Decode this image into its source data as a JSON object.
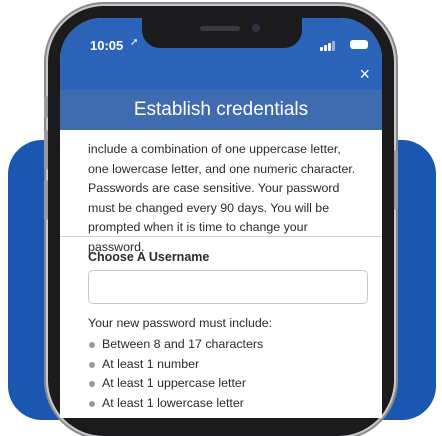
{
  "status_bar": {
    "time": "10:05"
  },
  "modal": {
    "close_label": "×",
    "title": "Establish credentials",
    "intro_text": "include a combination of one uppercase letter, one lowercase letter, and one numeric character. Passwords are case sensitive. Your password must be changed every 90 days.  You will be prompted when it is time to change your password.",
    "username": {
      "label": "Choose A Username",
      "value": "",
      "placeholder": ""
    },
    "requirements": {
      "title": "Your new password must include:",
      "items": [
        "Between 8 and 17 characters",
        "At least 1 number",
        "At least 1 uppercase letter",
        "At least 1 lowercase letter"
      ]
    }
  },
  "colors": {
    "header_blue": "#2a63b8",
    "title_blue": "#3f6bb0",
    "background_card": "#1c56b3"
  }
}
